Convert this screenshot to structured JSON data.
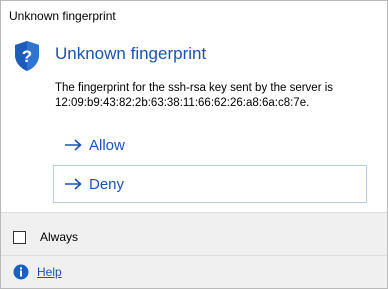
{
  "window": {
    "title": "Unknown fingerprint"
  },
  "dialog": {
    "heading": "Unknown fingerprint",
    "message_line1": "The fingerprint for the ssh-rsa key sent by the server is",
    "message_line2": "12:09:b9:43:82:2b:63:38:11:66:62:26:a8:6a:c8:7e."
  },
  "commands": {
    "allow_label": "Allow",
    "deny_label": "Deny"
  },
  "footer": {
    "checkbox_label": "Always",
    "checkbox_checked": false,
    "help_label": "Help"
  },
  "colors": {
    "accent": "#1a54b3",
    "footer_bg": "#f0f0f0",
    "deny_border": "#b7cde6"
  },
  "icons": {
    "dialog": "shield-icon",
    "command": "arrow-right-icon",
    "help": "info-icon"
  }
}
